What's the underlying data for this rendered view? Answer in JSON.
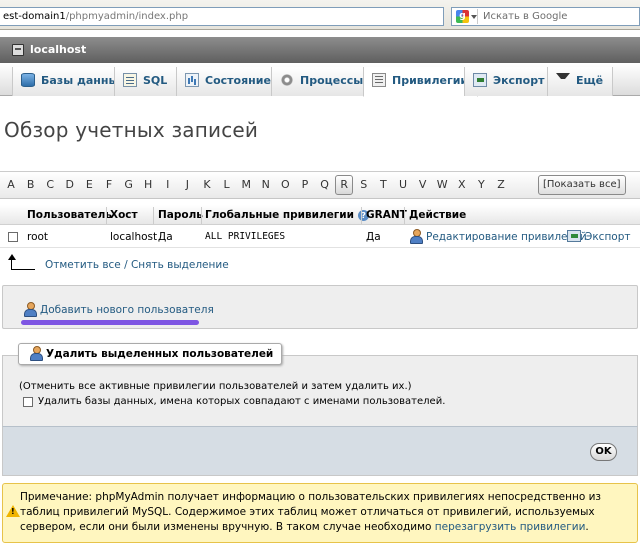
{
  "browser": {
    "url_host": "est-domain1",
    "url_path": "/phpmyadmin/index.php",
    "search_placeholder": "Искать в Google"
  },
  "server": {
    "label": "localhost"
  },
  "tabs": [
    {
      "label": "Базы данных",
      "icon": "database-icon"
    },
    {
      "label": "SQL",
      "icon": "sql-icon"
    },
    {
      "label": "Состояние",
      "icon": "status-icon"
    },
    {
      "label": "Процессы",
      "icon": "gear-icon"
    },
    {
      "label": "Привилегии",
      "icon": "privileges-icon",
      "active": true
    },
    {
      "label": "Экспорт",
      "icon": "export-icon"
    },
    {
      "label": "Ещё",
      "icon": "chevron-down-icon"
    }
  ],
  "page_title": "Обзор учетных записей",
  "alphabet": [
    "A",
    "B",
    "C",
    "D",
    "E",
    "F",
    "G",
    "H",
    "I",
    "J",
    "K",
    "L",
    "M",
    "N",
    "O",
    "P",
    "Q",
    "R",
    "S",
    "T",
    "U",
    "V",
    "W",
    "X",
    "Y",
    "Z"
  ],
  "active_letter": "R",
  "show_all": "[Показать все]",
  "table": {
    "headers": {
      "user": "Пользователь",
      "host": "Хост",
      "password": "Пароль",
      "global_privileges": "Глобальные привилегии",
      "grant": "GRANT",
      "action": "Действие"
    },
    "rows": [
      {
        "user": "root",
        "host": "localhost",
        "password": "Да",
        "global_privileges": "ALL PRIVILEGES",
        "grant": "Да",
        "edit_label": "Редактирование привилегий",
        "export_label": "Экспорт"
      }
    ]
  },
  "check_all": "Отметить все / Снять выделение",
  "add_user": "Добавить нового пользователя",
  "delete": {
    "legend": "Удалить выделенных пользователей",
    "note": "(Отменить все активные привилегии пользователей и затем удалить их.)",
    "drop_db_label": "Удалить базы данных, имена которых совпадают с именами пользователей.",
    "ok": "OK"
  },
  "notice": {
    "text": "Примечание: phpMyAdmin получает информацию о пользовательских привилегиях непосредственно из таблиц привилегий MySQL. Содержимое этих таблиц может отличаться от привилегий, используемых сервером, если они были изменены вручную. В таком случае необходимо ",
    "link": "перезагрузить привилегии",
    "tail": "."
  }
}
